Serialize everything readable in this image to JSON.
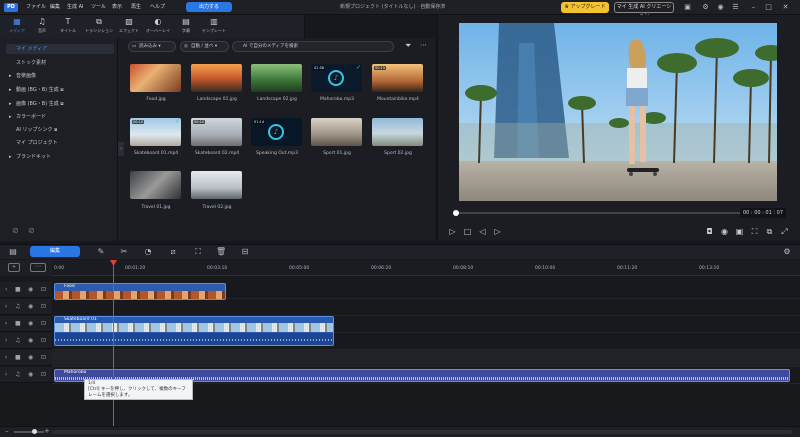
{
  "app": {
    "logo": "PD",
    "menus": [
      "ファイル",
      "編集",
      "生成 AI",
      "ツール",
      "表示",
      "再生",
      "ヘルプ"
    ],
    "export_label": "出力する",
    "project_title": "新規プロジェクト (タイトルなし)",
    "saved_status": "自動保存済",
    "upgrade_label": "アップグレード",
    "ai_creation_label": "マイ 生成 AI クリエーション"
  },
  "toolbar": {
    "items": [
      {
        "label": "メディア",
        "icon": "media-icon"
      },
      {
        "label": "音声",
        "icon": "music-icon"
      },
      {
        "label": "タイトル",
        "icon": "text-icon"
      },
      {
        "label": "トランジション",
        "icon": "transition-icon"
      },
      {
        "label": "エフェクト",
        "icon": "effect-icon"
      },
      {
        "label": "オーバーレイ",
        "icon": "overlay-icon"
      },
      {
        "label": "字幕",
        "icon": "subtitle-icon"
      },
      {
        "label": "テンプレート",
        "icon": "template-icon"
      }
    ]
  },
  "sidebar": {
    "items": [
      {
        "label": "マイ メディア",
        "active": true
      },
      {
        "label": "ストック素材"
      },
      {
        "label": "音楽画像"
      },
      {
        "label": "動画 (BG・B) 生成"
      },
      {
        "label": "画像 (BG・B) 生成"
      },
      {
        "label": "カラーボード"
      },
      {
        "label": "AI リップシンク"
      },
      {
        "label": "マイ プロジェクト"
      },
      {
        "label": "ブランドキット"
      }
    ]
  },
  "media": {
    "import_label": "読み込み",
    "sort_label": "自動 / 並べ",
    "search_placeholder": "AI で自分のメディアを検索",
    "items": [
      {
        "name": "Food.jpg",
        "type": "image"
      },
      {
        "name": "Landscape 01.jpg",
        "type": "image"
      },
      {
        "name": "Landscape 02.jpg",
        "type": "image"
      },
      {
        "name": "Mahoroba.mp3",
        "type": "audio",
        "duration": "02:58"
      },
      {
        "name": "Mountainbike.mp4",
        "type": "video",
        "duration": "00:15"
      },
      {
        "name": "Skateboard 01.mp4",
        "type": "video",
        "duration": "00:10"
      },
      {
        "name": "Skateboard 02.mp4",
        "type": "video",
        "duration": "00:10"
      },
      {
        "name": "Speaking Out.mp3",
        "type": "audio",
        "duration": "01:14"
      },
      {
        "name": "Sport 01.jpg",
        "type": "image"
      },
      {
        "name": "Sport 02.jpg",
        "type": "image"
      },
      {
        "name": "Travel 01.jpg",
        "type": "image"
      },
      {
        "name": "Travel 02.jpg",
        "type": "image"
      }
    ]
  },
  "preview": {
    "timecode": "00 : 00 : 01 : 07",
    "progress": 0.01
  },
  "timeline": {
    "edit_label": "編集",
    "ruler": [
      "0:00",
      "00:01:20",
      "00:03:10",
      "00:05:00",
      "00:06:20",
      "00:08:10",
      "00:10:00",
      "00:11:20",
      "00:13:10"
    ],
    "clips": {
      "food": "Food",
      "skateboard": "Skateboard 01",
      "music": "Mahoroba"
    },
    "tooltip_title": "1/4",
    "tooltip_text": "[Ctrl] キーを押し、クリックして、複数のキーフレームを選択します。"
  }
}
